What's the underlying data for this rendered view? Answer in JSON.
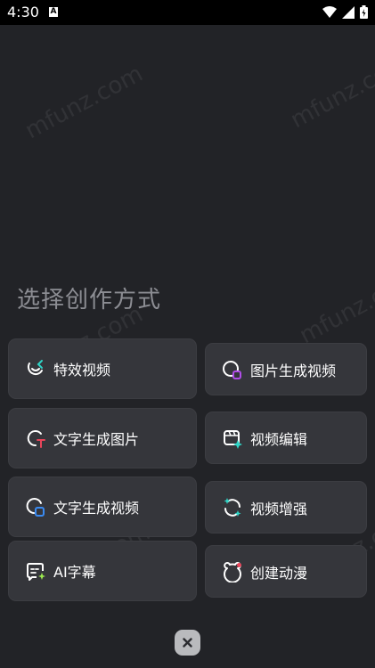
{
  "status_bar": {
    "time": "4:30",
    "notification_letter": "A"
  },
  "watermark": "mfunz.com",
  "title": "选择创作方式",
  "options": [
    {
      "label": "特效视频",
      "icon": "effects-video-icon"
    },
    {
      "label": "图片生成视频",
      "icon": "image-to-video-icon"
    },
    {
      "label": "文字生成图片",
      "icon": "text-to-image-icon"
    },
    {
      "label": "视频编辑",
      "icon": "video-edit-icon"
    },
    {
      "label": "文字生成视频",
      "icon": "text-to-video-icon"
    },
    {
      "label": "视频增强",
      "icon": "video-enhance-icon"
    },
    {
      "label": "AI字幕",
      "icon": "ai-subtitle-icon"
    },
    {
      "label": "创建动漫",
      "icon": "create-anime-icon"
    }
  ],
  "colors": {
    "background": "#222327",
    "card": "#35363b",
    "title": "#8c8d93",
    "accent_cyan": "#2fd6c8",
    "accent_purple": "#b04de8",
    "accent_red": "#e8455a",
    "accent_blue": "#3a8bf2",
    "accent_green": "#9be84f"
  }
}
